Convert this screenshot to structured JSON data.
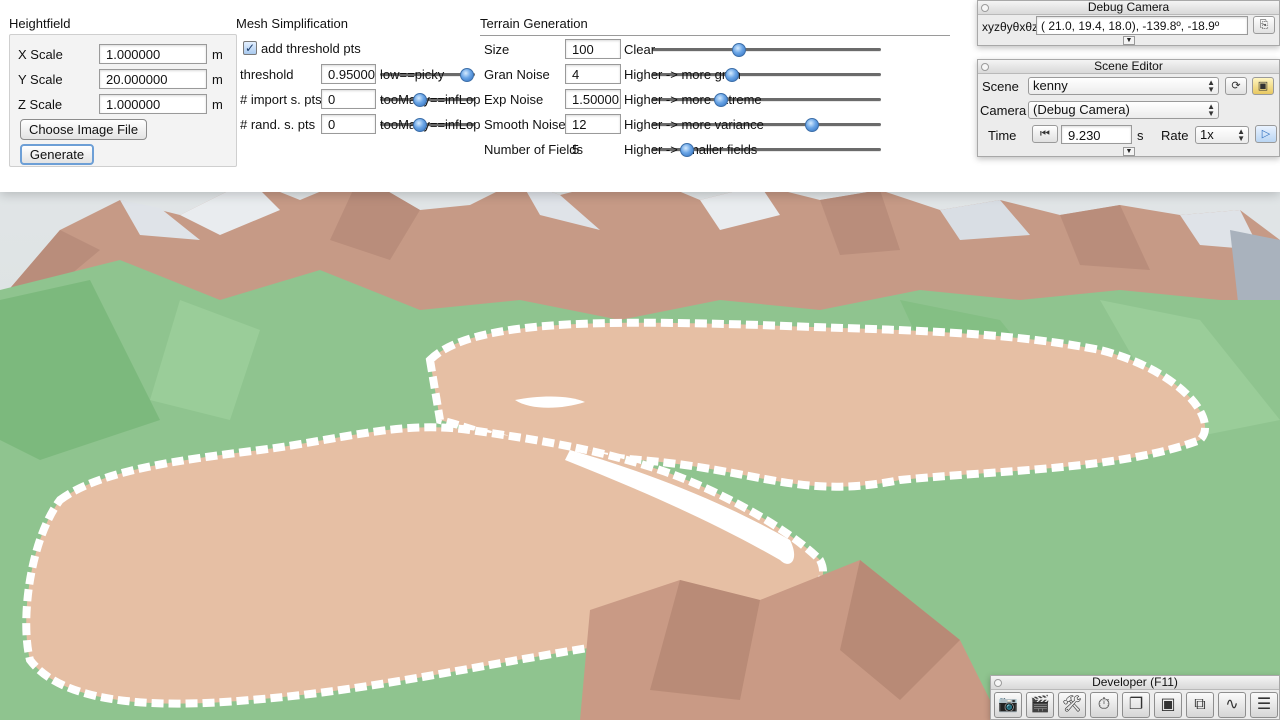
{
  "heightfield": {
    "title": "Heightfield",
    "x_scale": {
      "label": "X Scale",
      "value": "1.000000",
      "unit": "m"
    },
    "y_scale": {
      "label": "Y Scale",
      "value": "20.000000",
      "unit": "m"
    },
    "z_scale": {
      "label": "Z Scale",
      "value": "1.000000",
      "unit": "m"
    },
    "choose_button": "Choose Image File",
    "generate_button": "Generate"
  },
  "mesh": {
    "title": "Mesh Simplification",
    "add_threshold": {
      "label": "add threshold pts",
      "checked": true,
      "check_glyph": "✓"
    },
    "threshold": {
      "label": "threshold",
      "value": "0.95000",
      "hint": "low==picky",
      "level": 0.97
    },
    "import_pts": {
      "label": "# import s. pts",
      "value": "0",
      "hint": "tooMany==infLop",
      "level": 0.0
    },
    "rand_pts": {
      "label": "# rand. s. pts",
      "value": "0",
      "hint": "tooMany==infLop",
      "level": 0.0
    }
  },
  "terrain": {
    "title": "Terrain Generation",
    "rows": [
      {
        "label": "Size",
        "value": "100",
        "hint": "Clear",
        "level": 0.37
      },
      {
        "label": "Gran Noise",
        "value": "4",
        "hint": "Higher -> more gran",
        "level": 0.34
      },
      {
        "label": "Exp Noise",
        "value": "1.50000",
        "hint": "Higher -> more extreme",
        "level": 0.29
      },
      {
        "label": "Smooth Noise",
        "value": "12",
        "hint": "Higher -> more variance",
        "level": 0.71
      },
      {
        "label": "Number of Fields",
        "value": "5",
        "hint": "Higher -> smaller fields",
        "level": 0.13
      }
    ]
  },
  "debug_camera": {
    "title": "Debug Camera",
    "label": "xyzθyθxθz",
    "value": "( 21.0,  19.4,  18.0), -139.8º, -18.9º",
    "copy_icon": "copy-icon"
  },
  "scene_editor": {
    "title": "Scene Editor",
    "scene_label": "Scene",
    "scene_value": "kenny",
    "camera_label": "Camera",
    "camera_value": "(Debug Camera)",
    "time_label": "Time",
    "time_value": "9.230",
    "time_unit": "s",
    "rate_label": "Rate",
    "rate_value": "1x",
    "reload_glyph": "⟳",
    "lock_glyph": "🔒",
    "reset_glyph": "⏮",
    "play_glyph": "▷"
  },
  "developer": {
    "title": "Developer (F11)",
    "tools": [
      {
        "name": "camera-icon",
        "glyph": "📷"
      },
      {
        "name": "clapper-icon",
        "glyph": "🎬"
      },
      {
        "name": "tools-icon",
        "glyph": "🛠"
      },
      {
        "name": "stopwatch-icon",
        "glyph": "⏱"
      },
      {
        "name": "new-window-icon",
        "glyph": "❐"
      },
      {
        "name": "console-icon",
        "glyph": "▣"
      },
      {
        "name": "scene-graph-icon",
        "glyph": "⧉"
      },
      {
        "name": "profiler-icon",
        "glyph": "∿"
      },
      {
        "name": "notes-icon",
        "glyph": "☰"
      }
    ]
  },
  "colors": {
    "terrain_sand": "#e6bfa4",
    "terrain_grass": "#8fc48f",
    "terrain_rock": "#c99a85",
    "snow": "#ffffff",
    "accent": "#4a88d4"
  }
}
